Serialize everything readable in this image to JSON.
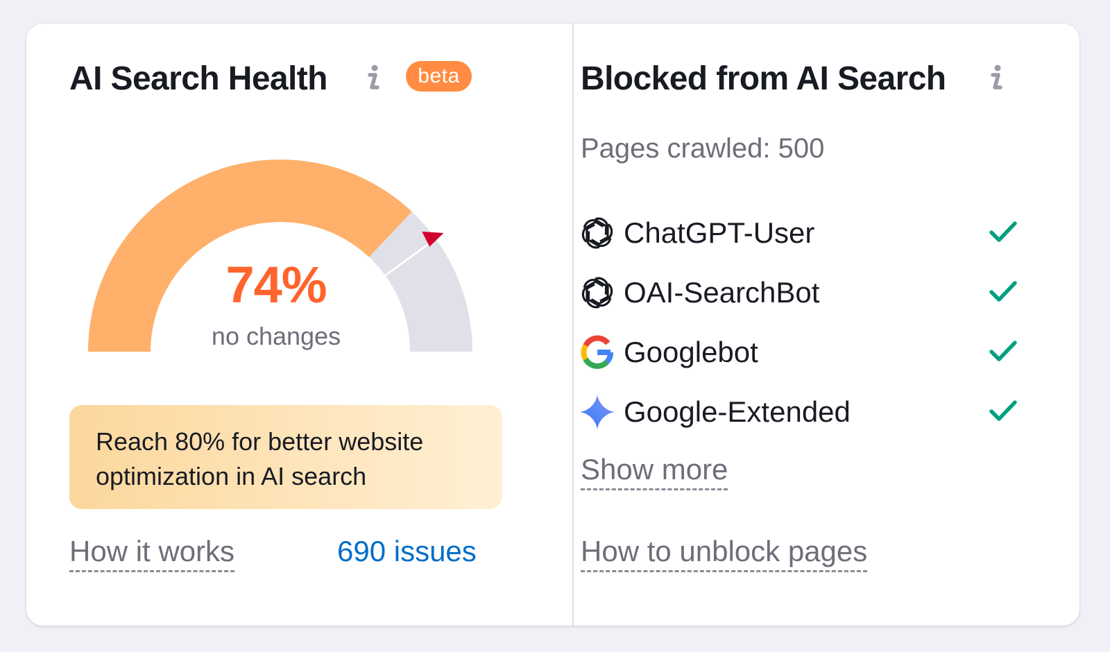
{
  "health": {
    "title": "AI Search Health",
    "badge": "beta",
    "score": "74%",
    "score_value": 74,
    "target_value": 80,
    "change": "no changes",
    "hint": "Reach 80% for better website optimization in AI search",
    "how_link": "How it works",
    "issues_link": "690 issues",
    "colors": {
      "fill": "#ffb06b",
      "track": "#e0e1e8",
      "marker": "#d1002f",
      "score": "#ff642d"
    }
  },
  "blocked": {
    "title": "Blocked from AI Search",
    "pages_crawled": "Pages crawled: 500",
    "bots": [
      {
        "name": "ChatGPT-User",
        "icon": "openai-icon",
        "status": "check-icon"
      },
      {
        "name": "OAI-SearchBot",
        "icon": "openai-icon",
        "status": "check-icon"
      },
      {
        "name": "Googlebot",
        "icon": "google-icon",
        "status": "check-icon"
      },
      {
        "name": "Google-Extended",
        "icon": "gemini-sparkle-icon",
        "status": "check-icon"
      }
    ],
    "show_more": "Show more",
    "unblock_link": "How to unblock pages",
    "colors": {
      "check": "#009f81"
    }
  }
}
